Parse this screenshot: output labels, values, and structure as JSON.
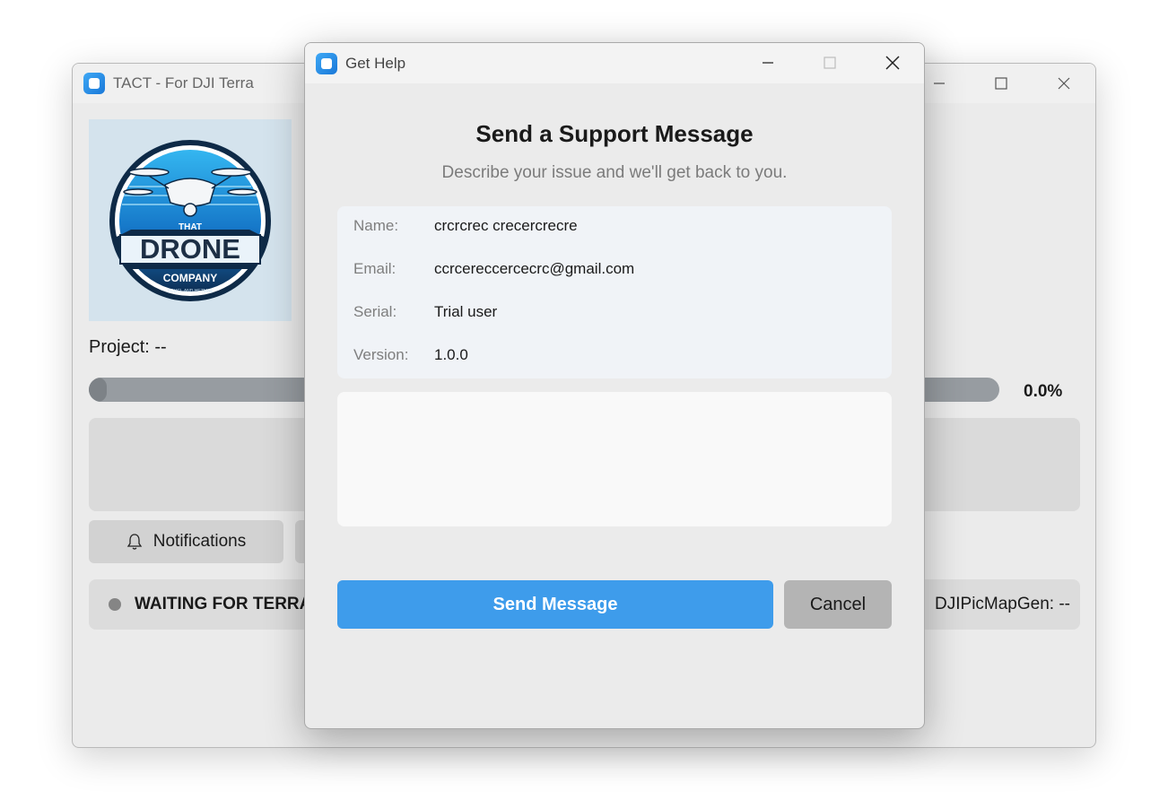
{
  "main_window": {
    "title": "TACT - For DJI Terra",
    "logo": {
      "top_text": "THAT",
      "main_text": "DRONE",
      "sub_text": "COMPANY",
      "tagline": "YOUGL AND HETMAE"
    },
    "project_label": "Project: --",
    "progress": {
      "value_fraction": 0.0,
      "text": "0.0%"
    },
    "notifications_button": "Notifications",
    "status_text": "WAITING FOR TERRA",
    "status_right": "DJIPicMapGen: --",
    "colors": {
      "status_dot": "#858585",
      "progress_track": "#979ca1"
    }
  },
  "dialog": {
    "title": "Get Help",
    "heading": "Send a Support Message",
    "subtitle": "Describe your issue and we'll get back to you.",
    "fields": [
      {
        "label": "Name:",
        "value": "crcrcrec crecercrecre"
      },
      {
        "label": "Email:",
        "value": "ccrcereccercecrc@gmail.com"
      },
      {
        "label": "Serial:",
        "value": "Trial user"
      },
      {
        "label": "Version:",
        "value": "1.0.0"
      }
    ],
    "message": {
      "value": "",
      "placeholder": ""
    },
    "send_button": "Send Message",
    "cancel_button": "Cancel",
    "colors": {
      "send": "#3e9ceb",
      "cancel": "#b4b4b4",
      "info_card": "#f0f3f7"
    }
  },
  "icons": {
    "app": "app-icon",
    "minimize": "minimize-icon",
    "maximize": "maximize-icon",
    "close": "close-icon",
    "bell": "bell-icon"
  }
}
